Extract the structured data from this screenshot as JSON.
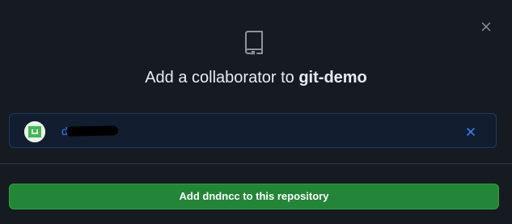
{
  "dialog": {
    "title_prefix": "Add a collaborator to ",
    "repo_name": "git-demo",
    "close_icon": "close-icon",
    "repo_icon": "repo-icon"
  },
  "selected_user": {
    "username": "dndncc",
    "username_redacted": true,
    "avatar_icon": "identicon-avatar",
    "remove_icon": "close-icon"
  },
  "actions": {
    "add_button_label": "Add dndncc to this repository"
  },
  "colors": {
    "background": "#161b22",
    "accent_link": "#2f81f7",
    "primary_button": "#238636",
    "avatar_green": "#3fb950"
  }
}
